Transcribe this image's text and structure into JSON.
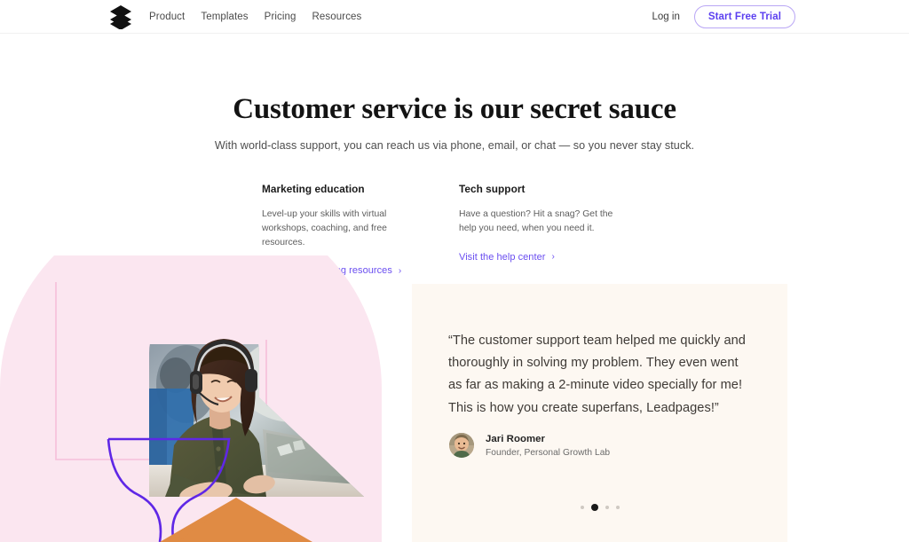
{
  "header": {
    "logo_icon": "stacked-layers-logo",
    "nav": [
      {
        "label": "Product"
      },
      {
        "label": "Templates"
      },
      {
        "label": "Pricing"
      },
      {
        "label": "Resources"
      }
    ],
    "login_label": "Log in",
    "cta_label": "Start Free Trial",
    "cta_border_color": "#b9a6f5",
    "cta_text_color": "#5b3ff0"
  },
  "hero": {
    "headline": "Customer service is our secret sauce",
    "subhead": "With world-class support, you can reach us via phone, email, or chat — so you never stay stuck."
  },
  "features": [
    {
      "title": "Marketing education",
      "body": "Level-up your skills with virtual workshops, coaching, and free resources.",
      "link_label": "Discover marketing resources",
      "link_icon": "chevron-right-icon"
    },
    {
      "title": "Tech support",
      "body": "Have a question? Hit a snag? Get the help you need, when you need it.",
      "link_label": "Visit the help center",
      "link_icon": "chevron-right-icon"
    }
  ],
  "testimonial": {
    "quote": "“The customer support team helped me quickly and thoroughly in solving my problem. They even went as far as making a 2-minute video specially for me! This is how you create superfans, Leadpages!”",
    "author_name": "Jari Roomer",
    "author_role": "Founder, Personal Growth Lab",
    "avatar_icon": "author-avatar-photo",
    "card_background": "#fdf8f2",
    "carousel": {
      "total": 4,
      "active_index": 1
    }
  },
  "decor": {
    "arch_color": "#fbe6f0",
    "rect_outline_color": "#f6bfda",
    "purple_curve_color": "#5f27e6",
    "orange_triangle_color": "#e08b44",
    "photo_alt": "woman-with-headphones-at-laptop"
  },
  "link_color": "#6a4ef0"
}
